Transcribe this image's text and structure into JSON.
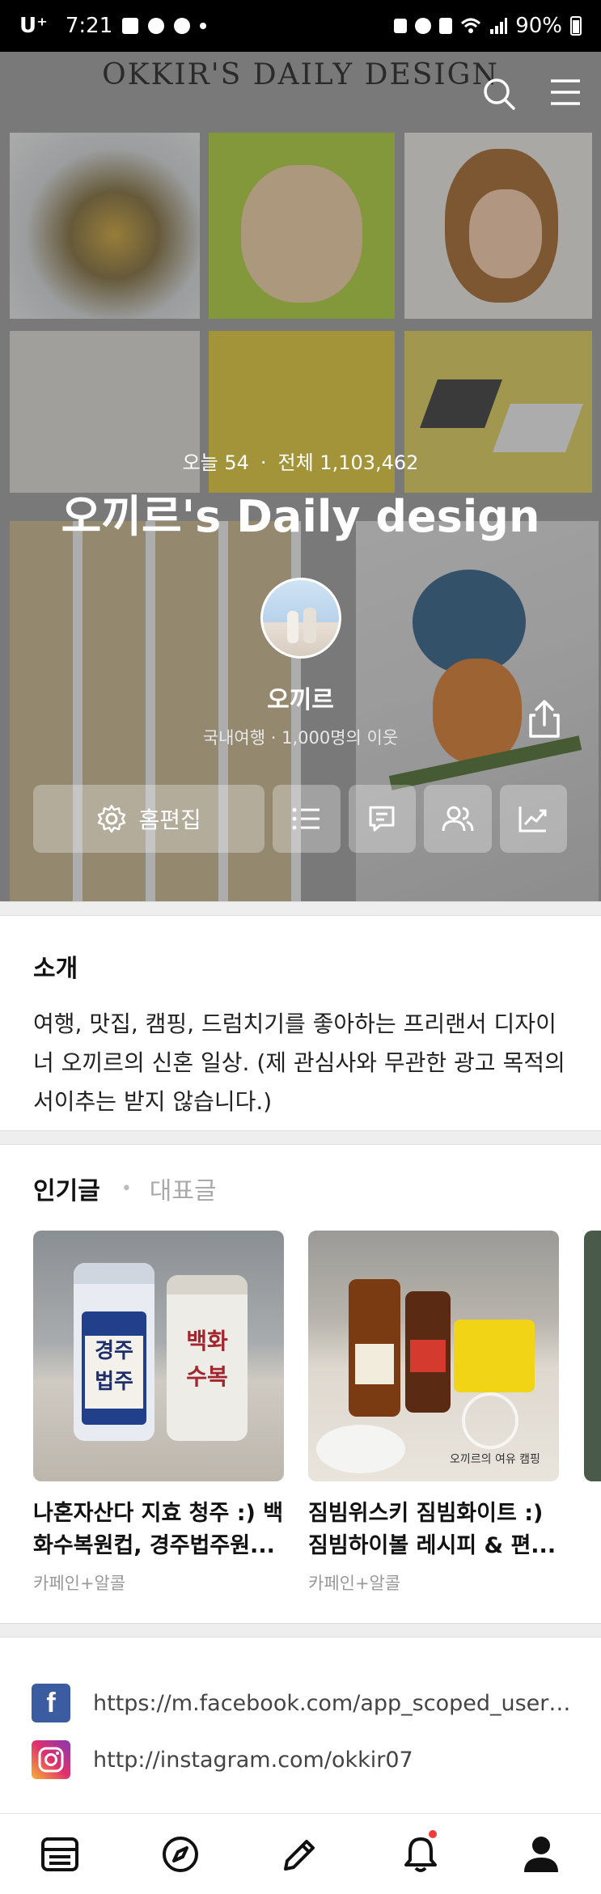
{
  "status_bar": {
    "carrier": "U⁺",
    "time": "7:21",
    "battery": "90%"
  },
  "hero": {
    "brand": "OKKIR'S DAILY DESIGN",
    "stats": {
      "today": "오늘 54",
      "separator": "·",
      "total": "전체 1,103,462"
    },
    "blog_title": "오끼르's Daily design",
    "nickname": "오끼르",
    "subinfo": "국내여행 · 1,000명의 이웃",
    "edit_home_label": "홈편집"
  },
  "intro": {
    "title": "소개",
    "text": "여행, 맛집, 캠핑, 드럼치기를 좋아하는 프리랜서 디자이너 오끼르의 신혼 일상. (제 관심사와 무관한 광고 목적의 서이추는 받지 않습니다.)"
  },
  "popular": {
    "tab_popular": "인기글",
    "tab_dot": "•",
    "tab_featured": "대표글",
    "cards": [
      {
        "title": "나혼자산다 지효 청주 :) 백화수복원컵, 경주법주원...",
        "category": "카페인+알콜"
      },
      {
        "title": "짐빔위스키 짐빔화이트 :) 짐빔하이볼 레시피 & 편...",
        "category": "카페인+알콜"
      }
    ],
    "card1_labels": {
      "left_bottle": "경주 법주",
      "right_bottle": "백화 수복"
    },
    "card2_labels": {
      "sign": "오끼르의 여유 캠핑"
    }
  },
  "links": {
    "facebook": "https://m.facebook.com/app_scoped_user_id/...",
    "instagram": "http://instagram.com/okkir07"
  },
  "nav": {
    "icons": [
      "feed-icon",
      "compass-icon",
      "pencil-icon",
      "bell-icon",
      "profile-icon"
    ]
  }
}
